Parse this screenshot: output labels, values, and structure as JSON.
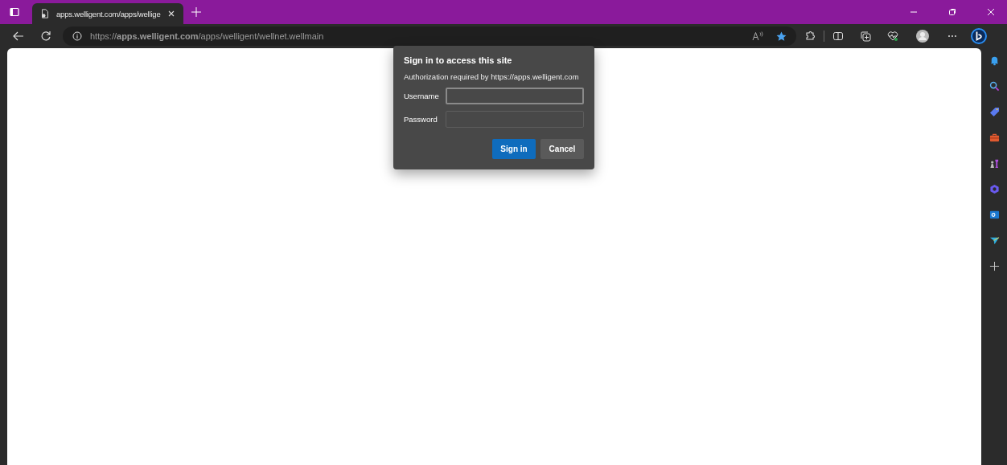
{
  "tab": {
    "title": "apps.welligent.com/apps/wellige",
    "selected": true
  },
  "address_bar": {
    "url": "https://**apps.welligent.com**/apps/welligent/wellnet.wellmain"
  },
  "dialog": {
    "title": "Sign in to access this site",
    "message": "Authorization required by https://apps.welligent.com",
    "fields": [
      {
        "label": "Username",
        "focused": true
      },
      {
        "label": "Password",
        "focused": false
      }
    ],
    "buttons": [
      {
        "label": "Sign in",
        "kind": "primary"
      },
      {
        "label": "Cancel",
        "kind": "secondary"
      }
    ]
  }
}
